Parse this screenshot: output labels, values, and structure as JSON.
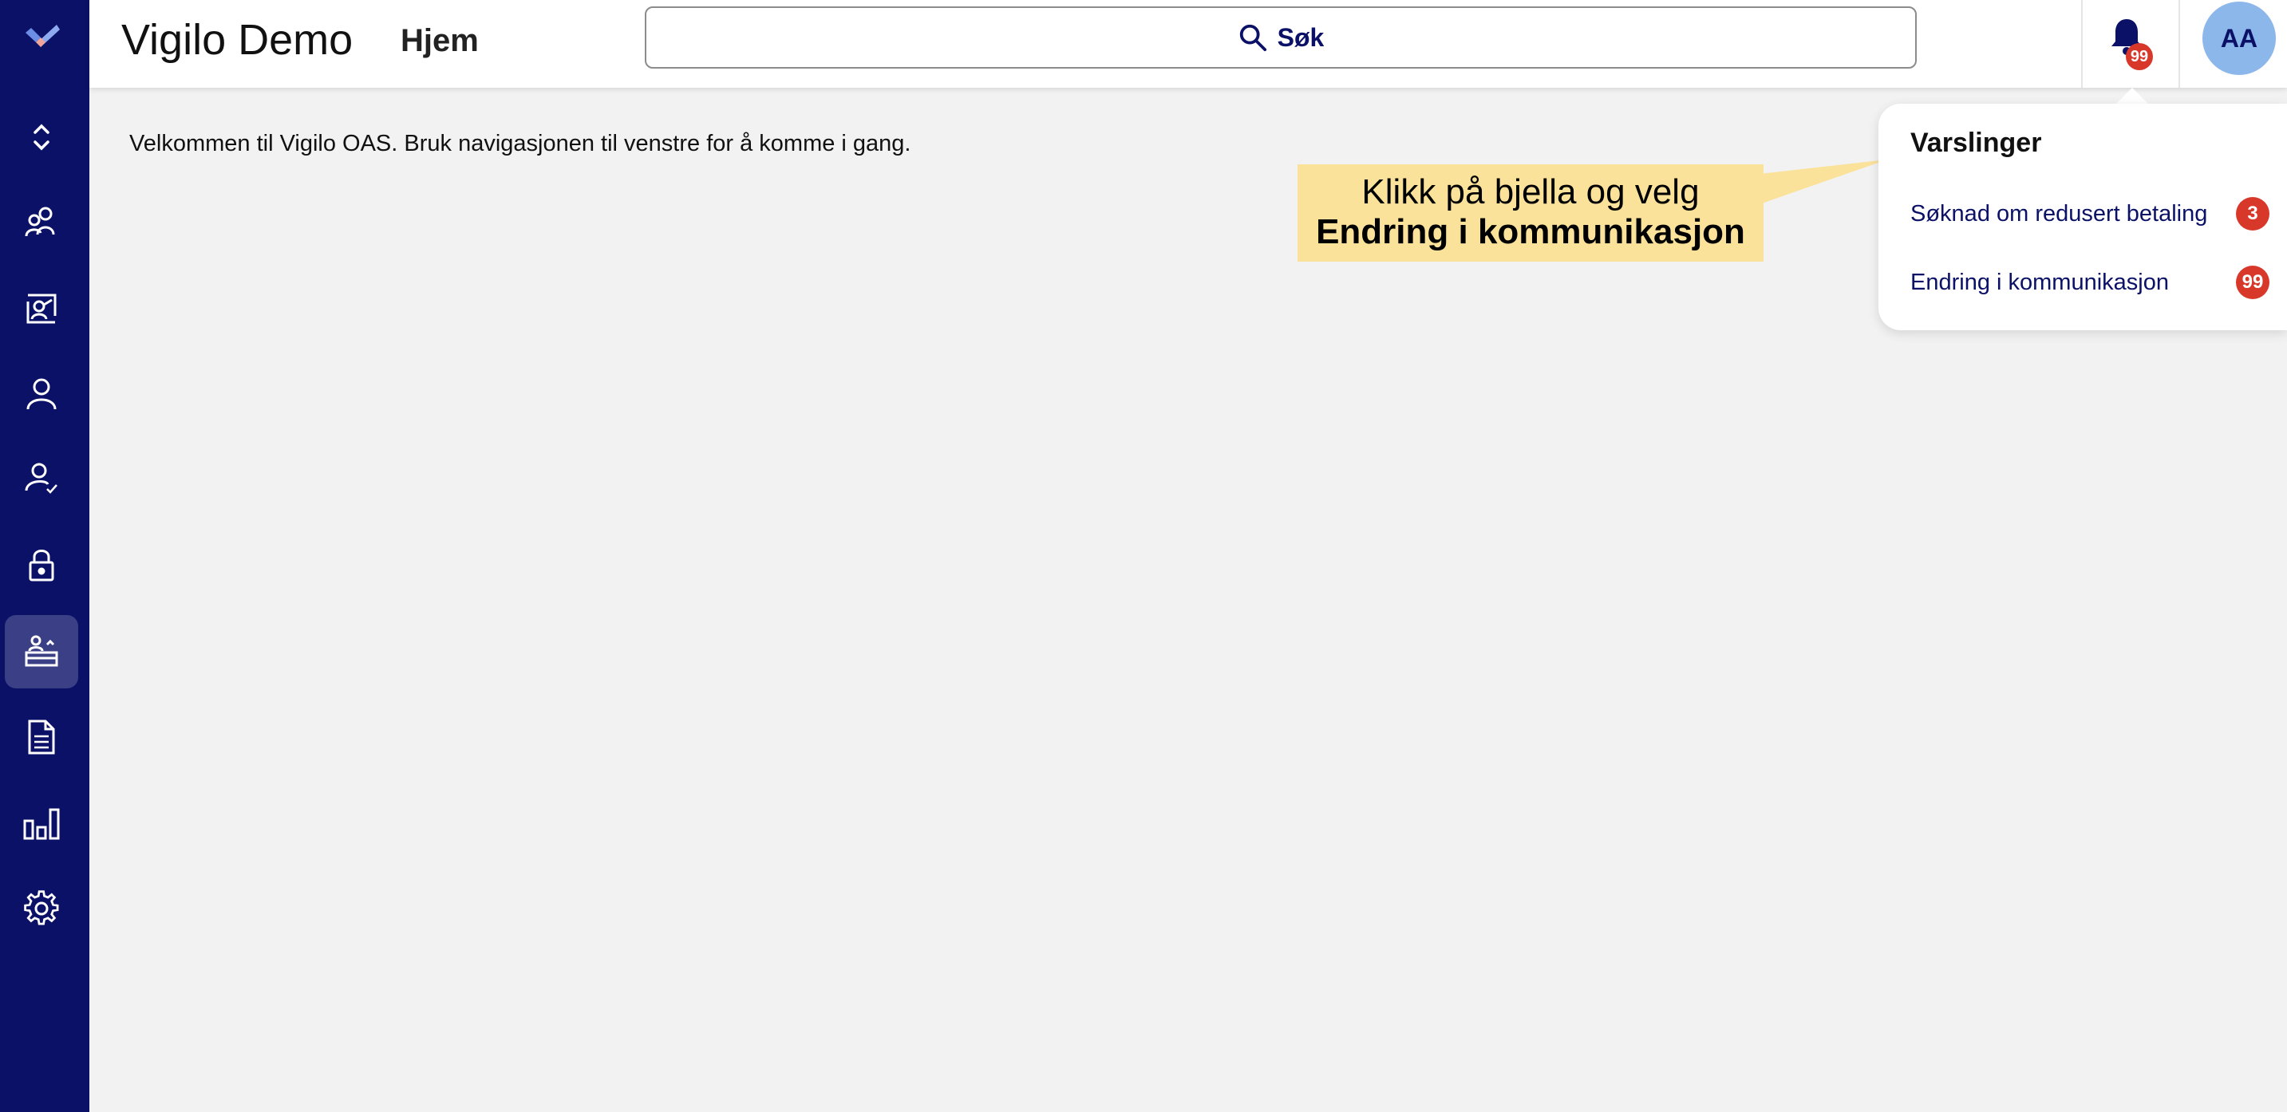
{
  "app": {
    "title": "Vigilo Demo",
    "home_label": "Hjem"
  },
  "search": {
    "label": "Søk"
  },
  "notifications": {
    "bell_count": "99",
    "title": "Varslinger",
    "items": [
      {
        "label": "Søknad om redusert betaling",
        "count": "3"
      },
      {
        "label": "Endring i kommunikasjon",
        "count": "99"
      }
    ]
  },
  "user": {
    "initials": "AA"
  },
  "main": {
    "welcome": "Velkommen til Vigilo OAS. Bruk navigasjonen til venstre for å komme i gang."
  },
  "callout": {
    "text_plain": "Klikk på bjella og velg ",
    "text_bold": "Endring i kommunikasjon"
  },
  "sidebar": {
    "items": [
      {
        "icon": "logo-icon"
      },
      {
        "icon": "expand-collapse-icon"
      },
      {
        "icon": "people-icon"
      },
      {
        "icon": "presentation-icon"
      },
      {
        "icon": "person-icon"
      },
      {
        "icon": "person-check-icon"
      },
      {
        "icon": "lock-icon"
      },
      {
        "icon": "basket-icon",
        "active": true
      },
      {
        "icon": "document-icon"
      },
      {
        "icon": "bar-chart-icon"
      },
      {
        "icon": "gear-icon"
      }
    ]
  },
  "colors": {
    "sidebar": "#0b1166",
    "accent": "#0b1166",
    "badge": "#d8382a",
    "callout": "#fbe29a",
    "avatar": "#8cb7ea"
  }
}
